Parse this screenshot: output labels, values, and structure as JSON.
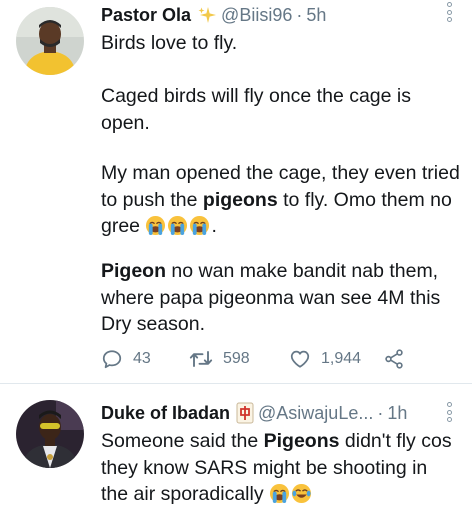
{
  "tweets": [
    {
      "name": "Pastor Ola",
      "badge_icon": "sparkles-icon",
      "handle": "@Biisi96",
      "separator": "·",
      "time": "5h",
      "paragraphs": [
        [
          "Birds love to fly."
        ],
        [
          "Caged birds will fly once the cage is",
          "open."
        ],
        [
          "My man opened the cage, they even tried",
          "to push the ",
          "pigeons",
          " to fly. Omo them no",
          "gree",
          "."
        ],
        [
          "Pigeon",
          " no wan make bandit nab them,",
          "where papa pigeonma wan see 4M this",
          "Dry season."
        ]
      ],
      "reply_count": "43",
      "retweet_count": "598",
      "like_count": "1,944"
    },
    {
      "name": "Duke of Ibadan",
      "badge_icon": "mahjong-red-dragon-icon",
      "handle": "@AsiwajuLe...",
      "separator": "·",
      "time": "1h",
      "lines": [
        "Someone said the ",
        "Pigeons",
        " didn't fly cos",
        "they know SARS might be shooting in",
        "the air sporadically"
      ]
    }
  ],
  "colors": {
    "text": "#14171a",
    "muted": "#657786",
    "divider": "#e1e8ed",
    "accent": "#f2c94c"
  },
  "emoji_icons": [
    "loudly-crying-face-icon",
    "face-with-tears-of-joy-icon"
  ]
}
